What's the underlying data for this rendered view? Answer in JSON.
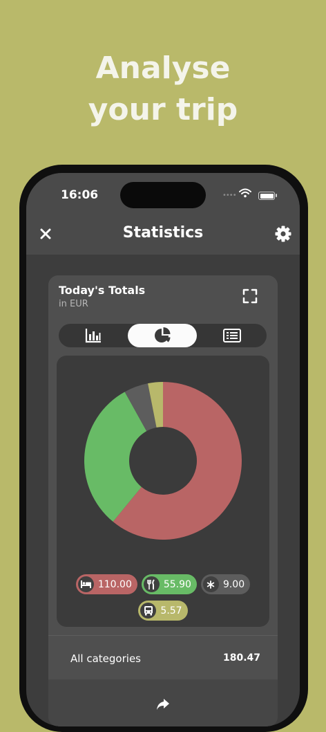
{
  "promo": {
    "line1": "Analyse",
    "line2": "your trip"
  },
  "status_bar": {
    "time": "16:06",
    "signal": "••••"
  },
  "nav": {
    "title": "Statistics",
    "close_icon": "close-icon",
    "settings_icon": "gear-icon"
  },
  "card": {
    "title": "Today's Totals",
    "subtitle": "in EUR",
    "expand_icon": "fullscreen-icon"
  },
  "view_tabs": [
    {
      "icon": "bar-chart-icon",
      "selected": false
    },
    {
      "icon": "pie-chart-icon",
      "selected": true
    },
    {
      "icon": "list-icon",
      "selected": false
    }
  ],
  "chart_data": {
    "type": "pie",
    "categories": [
      "Accommodation",
      "Food",
      "Other",
      "Transport"
    ],
    "values": [
      110.0,
      55.9,
      9.0,
      5.57
    ],
    "colors": [
      "#b96565",
      "#68bb66",
      "#5d5d5d",
      "#b8b86b"
    ]
  },
  "legend": [
    {
      "icon": "bed-icon",
      "label": "110.00",
      "color": "#b96565"
    },
    {
      "icon": "fork-knife-icon",
      "label": "55.90",
      "color": "#68bb66"
    },
    {
      "icon": "asterisk-icon",
      "label": "9.00",
      "color": "#5d5d5d"
    },
    {
      "icon": "bus-icon",
      "label": "5.57",
      "color": "#b8b86b"
    }
  ],
  "summary": {
    "label": "All categories",
    "value": "180.47"
  },
  "share": {
    "icon": "share-icon"
  },
  "colors": {
    "background": "#b9b96a",
    "screen": "#3d3d3d",
    "card": "#4f4f4f"
  }
}
